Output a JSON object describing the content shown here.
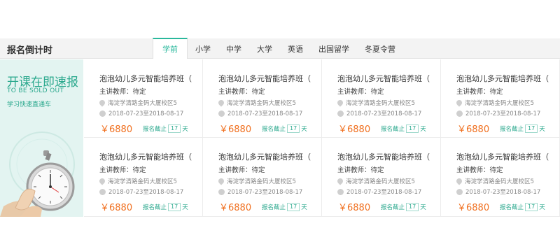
{
  "header": {
    "title": "报名倒计时",
    "tabs": [
      {
        "label": "学前",
        "active": true
      },
      {
        "label": "小学",
        "active": false
      },
      {
        "label": "中学",
        "active": false
      },
      {
        "label": "大学",
        "active": false
      },
      {
        "label": "英语",
        "active": false
      },
      {
        "label": "出国留学",
        "active": false
      },
      {
        "label": "冬夏令营",
        "active": false
      }
    ]
  },
  "promo": {
    "title": "开课在即速报",
    "subtitle": "TO BE SOLD OUT",
    "link": "学习快速直通车"
  },
  "cards": [
    {
      "title": "泡泡幼儿多元智能培养班（",
      "teacher": "主讲教师：待定",
      "address": "海淀学清路金码大厦校区5",
      "dates": "2018-07-23至2018-08-17",
      "price": "￥6880",
      "deadline_prefix": "报名截止",
      "days": "17",
      "deadline_suffix": "天"
    },
    {
      "title": "泡泡幼儿多元智能培养班（",
      "teacher": "主讲教师：待定",
      "address": "海淀学清路金码大厦校区5",
      "dates": "2018-07-23至2018-08-17",
      "price": "￥6880",
      "deadline_prefix": "报名截止",
      "days": "17",
      "deadline_suffix": "天"
    },
    {
      "title": "泡泡幼儿多元智能培养班（",
      "teacher": "主讲教师：待定",
      "address": "海淀学清路金码大厦校区5",
      "dates": "2018-07-23至2018-08-17",
      "price": "￥6880",
      "deadline_prefix": "报名截止",
      "days": "17",
      "deadline_suffix": "天"
    },
    {
      "title": "泡泡幼儿多元智能培养班（",
      "teacher": "主讲教师：待定",
      "address": "海淀学清路金码大厦校区5",
      "dates": "2018-07-23至2018-08-17",
      "price": "￥6880",
      "deadline_prefix": "报名截止",
      "days": "17",
      "deadline_suffix": "天"
    },
    {
      "title": "泡泡幼儿多元智能培养班（",
      "teacher": "主讲教师：待定",
      "address": "海淀学清路金码大厦校区5",
      "dates": "2018-07-23至2018-08-17",
      "price": "￥6880",
      "deadline_prefix": "报名截止",
      "days": "17",
      "deadline_suffix": "天"
    },
    {
      "title": "泡泡幼儿多元智能培养班（",
      "teacher": "主讲教师：待定",
      "address": "海淀学清路金码大厦校区5",
      "dates": "2018-07-23至2018-08-17",
      "price": "￥6880",
      "deadline_prefix": "报名截止",
      "days": "17",
      "deadline_suffix": "天"
    },
    {
      "title": "泡泡幼儿多元智能培养班（",
      "teacher": "主讲教师：待定",
      "address": "海淀学清路金码大厦校区5",
      "dates": "2018-07-23至2018-08-17",
      "price": "￥6880",
      "deadline_prefix": "报名截止",
      "days": "17",
      "deadline_suffix": "天"
    },
    {
      "title": "泡泡幼儿多元智能培养班（",
      "teacher": "主讲教师：待定",
      "address": "海淀学清路金码大厦校区5",
      "dates": "2018-07-23至2018-08-17",
      "price": "￥6880",
      "deadline_prefix": "报名截止",
      "days": "17",
      "deadline_suffix": "天"
    }
  ],
  "colors": {
    "accent": "#2aa88d",
    "price": "#f07020",
    "promo_bg": "#e3f4f1"
  },
  "icons": {
    "address": "location-pin-icon",
    "dates": "calendar-icon",
    "promo_art": "stopwatch-icon"
  }
}
